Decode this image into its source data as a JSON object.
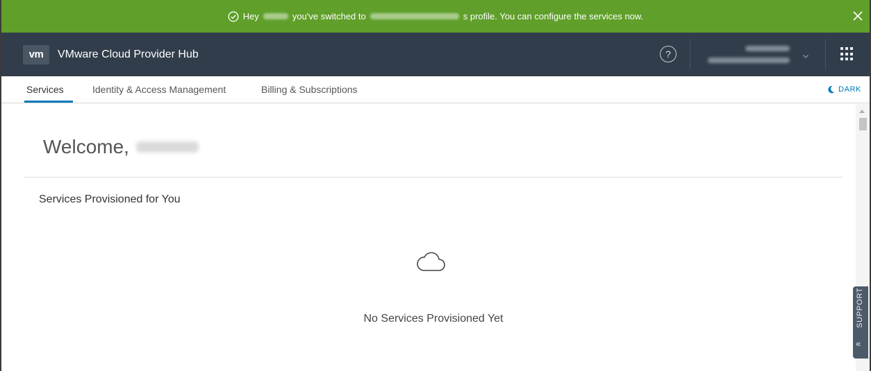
{
  "banner": {
    "prefix": "Hey",
    "middle": "you've switched to",
    "suffix": "s profile. You can configure the services now.",
    "color": "#5f9f2a"
  },
  "header": {
    "logo_text": "vm",
    "app_title": "VMware Cloud Provider Hub",
    "help_label": "?",
    "background": "#313d4b"
  },
  "nav": {
    "tabs": [
      {
        "label": "Services",
        "active": true
      },
      {
        "label": "Identity & Access Management",
        "active": false
      },
      {
        "label": "Billing & Subscriptions",
        "active": false
      }
    ],
    "theme_toggle": "DARK",
    "accent": "#0079b8"
  },
  "main": {
    "welcome_prefix": "Welcome,",
    "section_title": "Services Provisioned for You",
    "empty_state": "No Services Provisioned Yet",
    "empty_icon": "cloud-icon"
  },
  "support": {
    "label": "SUPPORT",
    "chevron": "«"
  }
}
